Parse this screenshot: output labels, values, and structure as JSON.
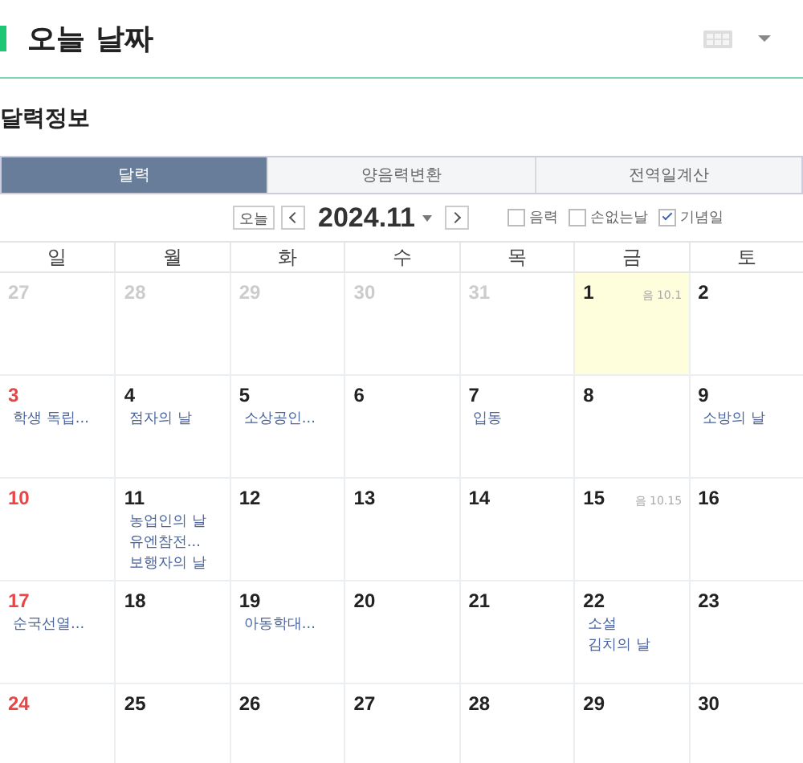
{
  "header": {
    "title": "오늘 날짜"
  },
  "section_title": "달력정보",
  "tabs": [
    {
      "label": "달력",
      "selected": true
    },
    {
      "label": "양음력변환",
      "selected": false
    },
    {
      "label": "전역일계산",
      "selected": false
    }
  ],
  "toolbar": {
    "today_button": "오늘",
    "month": "2024.11",
    "options": [
      {
        "label": "음력",
        "checked": false
      },
      {
        "label": "손없는날",
        "checked": false
      },
      {
        "label": "기념일",
        "checked": true
      }
    ]
  },
  "weekdays": [
    "일",
    "월",
    "화",
    "수",
    "목",
    "금",
    "토"
  ],
  "weeks": [
    [
      {
        "day": "27",
        "in_month": false
      },
      {
        "day": "28",
        "in_month": false
      },
      {
        "day": "29",
        "in_month": false
      },
      {
        "day": "30",
        "in_month": false
      },
      {
        "day": "31",
        "in_month": false
      },
      {
        "day": "1",
        "in_month": true,
        "today": true,
        "lunar": "음 10.1"
      },
      {
        "day": "2",
        "in_month": true
      }
    ],
    [
      {
        "day": "3",
        "in_month": true,
        "events": [
          "학생 독립..."
        ]
      },
      {
        "day": "4",
        "in_month": true,
        "events": [
          "점자의 날"
        ]
      },
      {
        "day": "5",
        "in_month": true,
        "events": [
          "소상공인..."
        ]
      },
      {
        "day": "6",
        "in_month": true
      },
      {
        "day": "7",
        "in_month": true,
        "events": [
          "입동"
        ]
      },
      {
        "day": "8",
        "in_month": true
      },
      {
        "day": "9",
        "in_month": true,
        "events": [
          "소방의 날"
        ]
      }
    ],
    [
      {
        "day": "10",
        "in_month": true
      },
      {
        "day": "11",
        "in_month": true,
        "events": [
          "농업인의 날",
          "유엔참전...",
          "보행자의 날"
        ]
      },
      {
        "day": "12",
        "in_month": true
      },
      {
        "day": "13",
        "in_month": true
      },
      {
        "day": "14",
        "in_month": true
      },
      {
        "day": "15",
        "in_month": true,
        "lunar": "음 10.15"
      },
      {
        "day": "16",
        "in_month": true
      }
    ],
    [
      {
        "day": "17",
        "in_month": true,
        "events": [
          "순국선열..."
        ]
      },
      {
        "day": "18",
        "in_month": true
      },
      {
        "day": "19",
        "in_month": true,
        "events": [
          "아동학대..."
        ]
      },
      {
        "day": "20",
        "in_month": true
      },
      {
        "day": "21",
        "in_month": true
      },
      {
        "day": "22",
        "in_month": true,
        "events": [
          "소설",
          "김치의 날"
        ]
      },
      {
        "day": "23",
        "in_month": true
      }
    ],
    [
      {
        "day": "24",
        "in_month": true
      },
      {
        "day": "25",
        "in_month": true
      },
      {
        "day": "26",
        "in_month": true
      },
      {
        "day": "27",
        "in_month": true
      },
      {
        "day": "28",
        "in_month": true
      },
      {
        "day": "29",
        "in_month": true
      },
      {
        "day": "30",
        "in_month": true
      }
    ]
  ]
}
